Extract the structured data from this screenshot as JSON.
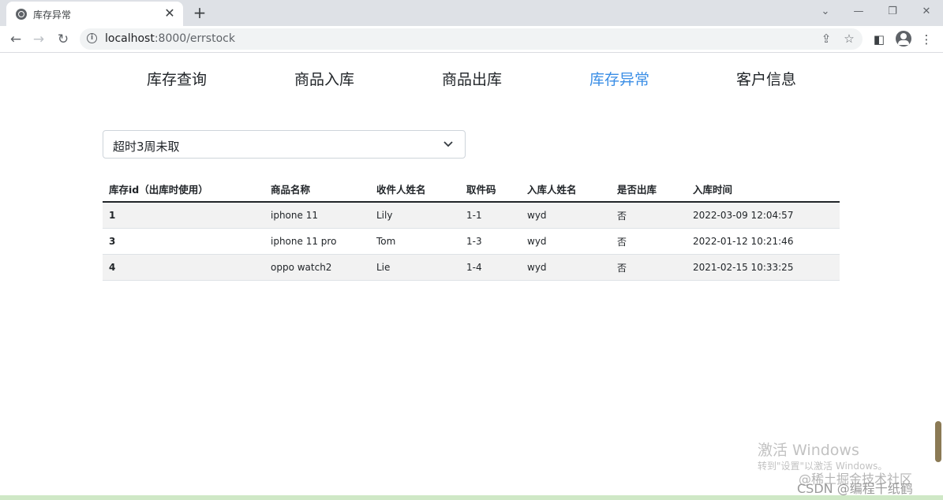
{
  "browser": {
    "tab_title": "库存异常",
    "tab_close": "✕",
    "new_tab": "+",
    "url_host": "localhost",
    "url_path": ":8000/errstock",
    "icons": [
      "globe-icon",
      "close-icon",
      "plus-icon",
      "back-arrow-icon",
      "forward-arrow-icon",
      "reload-icon",
      "info-icon",
      "share-icon",
      "star-icon",
      "side-panel-icon",
      "avatar-icon",
      "kebab-menu-icon"
    ]
  },
  "nav": {
    "items": [
      {
        "label": "库存查询"
      },
      {
        "label": "商品入库"
      },
      {
        "label": "商品出库"
      },
      {
        "label": "库存异常"
      },
      {
        "label": "客户信息"
      }
    ],
    "active_color": "#3a8ee6"
  },
  "filter": {
    "selected": "超时3周未取"
  },
  "table": {
    "headers": [
      "库存id（出库时使用）",
      "商品名称",
      "收件人姓名",
      "取件码",
      "入库人姓名",
      "是否出库",
      "入库时间"
    ],
    "rows": [
      [
        "1",
        "iphone 11",
        "Lily",
        "1-1",
        "wyd",
        "否",
        "2022-03-09 12:04:57"
      ],
      [
        "3",
        "iphone 11 pro",
        "Tom",
        "1-3",
        "wyd",
        "否",
        "2022-01-12 10:21:46"
      ],
      [
        "4",
        "oppo watch2",
        "Lie",
        "1-4",
        "wyd",
        "否",
        "2021-02-15 10:33:25"
      ]
    ]
  },
  "watermark": {
    "title": "激活 Windows",
    "subtitle": "转到\"设置\"以激活 Windows。",
    "site": "@稀土掘金技术社区",
    "csdn": "CSDN @编程千纸鹤"
  }
}
